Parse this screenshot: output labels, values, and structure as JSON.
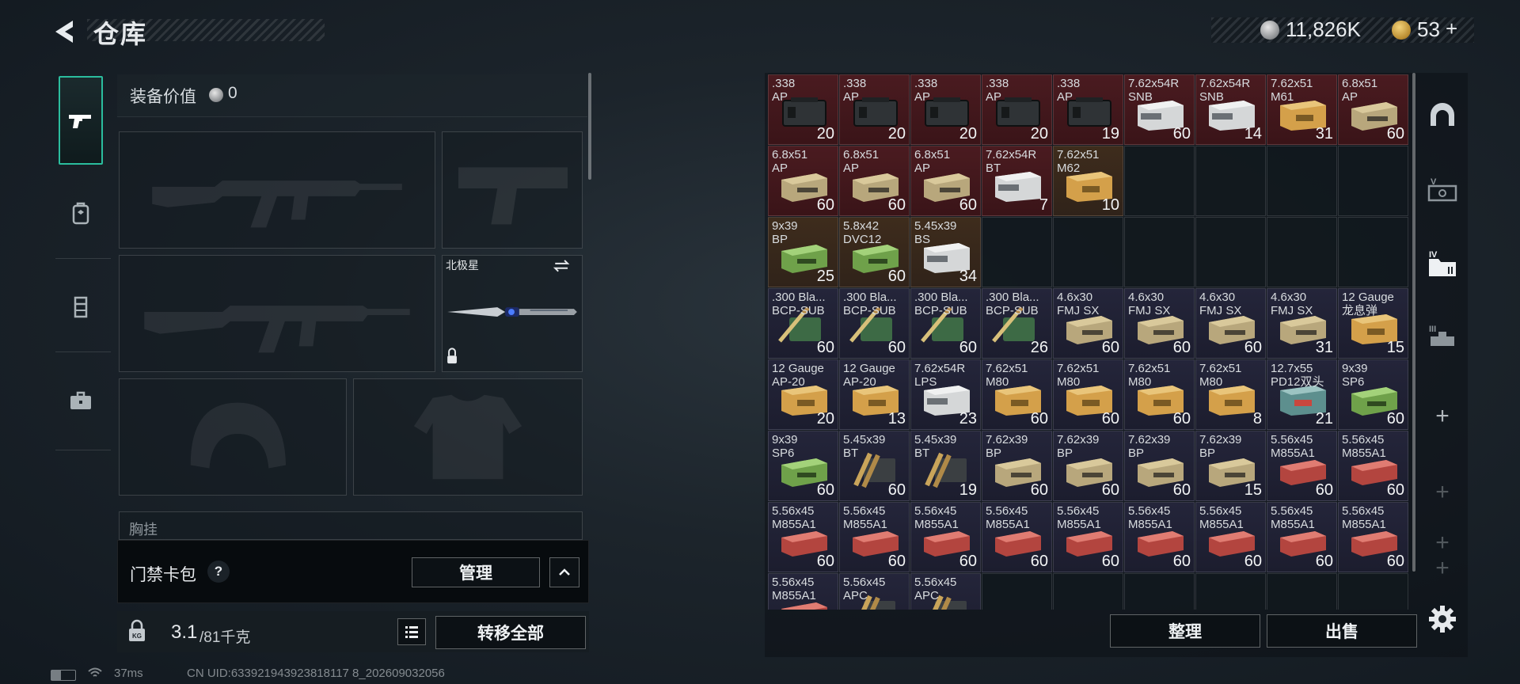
{
  "header": {
    "title": "仓库",
    "currency": [
      {
        "icon": "silver-coin-icon",
        "value": "11,826K"
      },
      {
        "icon": "gold-coin-icon",
        "value": "53"
      }
    ]
  },
  "side_nav": [
    {
      "icon": "pistol-icon",
      "active": true
    },
    {
      "icon": "backpack-plate-icon",
      "active": false
    },
    {
      "icon": "vest-icon",
      "active": false
    },
    {
      "icon": "briefcase-icon",
      "active": false
    }
  ],
  "loadout": {
    "value_label": "装备价值",
    "value_amount": "0",
    "melee_name": "北极星",
    "chest_label": "胸挂"
  },
  "keycard": {
    "label": "门禁卡包",
    "help": "?",
    "manage": "管理"
  },
  "weight": {
    "current": "3.1",
    "max": "/81千克",
    "transfer_all": "转移全部"
  },
  "status": {
    "ping": "37ms",
    "uid": "CN UID:633921943923818117 8_202609032056"
  },
  "stash": {
    "sort_label": "整理",
    "sell_label": "出售",
    "rows": [
      [
        {
          "name": ".338\nAP",
          "count": "20",
          "tone": "red",
          "box": "dark"
        },
        {
          "name": ".338\nAP",
          "count": "20",
          "tone": "red",
          "box": "dark"
        },
        {
          "name": ".338\nAP",
          "count": "20",
          "tone": "red",
          "box": "dark"
        },
        {
          "name": ".338\nAP",
          "count": "20",
          "tone": "red",
          "box": "dark"
        },
        {
          "name": ".338\nAP",
          "count": "19",
          "tone": "red",
          "box": "dark"
        },
        {
          "name": "7.62x54R\nSNB",
          "count": "60",
          "tone": "red",
          "box": "white"
        },
        {
          "name": "7.62x54R\nSNB",
          "count": "14",
          "tone": "red",
          "box": "white"
        },
        {
          "name": "7.62x51\nM61",
          "count": "31",
          "tone": "red",
          "box": "yellow"
        },
        {
          "name": "6.8x51\nAP",
          "count": "60",
          "tone": "red",
          "box": "tan"
        }
      ],
      [
        {
          "name": "6.8x51\nAP",
          "count": "60",
          "tone": "red",
          "box": "tan"
        },
        {
          "name": "6.8x51\nAP",
          "count": "60",
          "tone": "red",
          "box": "tan"
        },
        {
          "name": "6.8x51\nAP",
          "count": "60",
          "tone": "red",
          "box": "tan"
        },
        {
          "name": "7.62x54R\nBT",
          "count": "7",
          "tone": "red",
          "box": "white"
        },
        {
          "name": "7.62x51\nM62",
          "count": "10",
          "tone": "brown",
          "box": "yellow"
        },
        null,
        null,
        null,
        null
      ],
      [
        {
          "name": "9x39\nBP",
          "count": "25",
          "tone": "brown",
          "box": "green"
        },
        {
          "name": "5.8x42\nDVC12",
          "count": "60",
          "tone": "brown",
          "box": "green"
        },
        {
          "name": "5.45x39\nBS",
          "count": "34",
          "tone": "brown",
          "box": "white"
        },
        null,
        null,
        null,
        null,
        null,
        null
      ],
      [
        {
          "name": ".300 Bla...\nBCP-SUB",
          "count": "60",
          "tone": "purple",
          "box": "greenround"
        },
        {
          "name": ".300 Bla...\nBCP-SUB",
          "count": "60",
          "tone": "purple",
          "box": "greenround"
        },
        {
          "name": ".300 Bla...\nBCP-SUB",
          "count": "60",
          "tone": "purple",
          "box": "greenround"
        },
        {
          "name": ".300 Bla...\nBCP-SUB",
          "count": "26",
          "tone": "purple",
          "box": "greenround"
        },
        {
          "name": "4.6x30\nFMJ SX",
          "count": "60",
          "tone": "purple",
          "box": "tan"
        },
        {
          "name": "4.6x30\nFMJ SX",
          "count": "60",
          "tone": "purple",
          "box": "tan"
        },
        {
          "name": "4.6x30\nFMJ SX",
          "count": "60",
          "tone": "purple",
          "box": "tan"
        },
        {
          "name": "4.6x30\nFMJ SX",
          "count": "31",
          "tone": "purple",
          "box": "tan"
        },
        {
          "name": "12 Gauge\n龙息弹",
          "count": "15",
          "tone": "purple",
          "box": "yellow"
        }
      ],
      [
        {
          "name": "12 Gauge\nAP-20",
          "count": "20",
          "tone": "purple",
          "box": "yellow"
        },
        {
          "name": "12 Gauge\nAP-20",
          "count": "13",
          "tone": "purple",
          "box": "yellow"
        },
        {
          "name": "7.62x54R\nLPS",
          "count": "23",
          "tone": "purple",
          "box": "white"
        },
        {
          "name": "7.62x51\nM80",
          "count": "60",
          "tone": "purple",
          "box": "yellow"
        },
        {
          "name": "7.62x51\nM80",
          "count": "60",
          "tone": "purple",
          "box": "yellow"
        },
        {
          "name": "7.62x51\nM80",
          "count": "60",
          "tone": "purple",
          "box": "yellow"
        },
        {
          "name": "7.62x51\nM80",
          "count": "8",
          "tone": "purple",
          "box": "yellow"
        },
        {
          "name": "12.7x55\nPD12双头",
          "count": "21",
          "tone": "purple",
          "box": "teal"
        },
        {
          "name": "9x39\nSP6",
          "count": "60",
          "tone": "purple",
          "box": "green"
        }
      ],
      [
        {
          "name": "9x39\nSP6",
          "count": "60",
          "tone": "purple",
          "box": "green"
        },
        {
          "name": "5.45x39\nBT",
          "count": "60",
          "tone": "purple",
          "box": "bullets"
        },
        {
          "name": "5.45x39\nBT",
          "count": "19",
          "tone": "purple",
          "box": "bullets"
        },
        {
          "name": "7.62x39\nBP",
          "count": "60",
          "tone": "purple",
          "box": "tan"
        },
        {
          "name": "7.62x39\nBP",
          "count": "60",
          "tone": "purple",
          "box": "tan"
        },
        {
          "name": "7.62x39\nBP",
          "count": "60",
          "tone": "purple",
          "box": "tan"
        },
        {
          "name": "7.62x39\nBP",
          "count": "15",
          "tone": "purple",
          "box": "tan"
        },
        {
          "name": "5.56x45\nM855A1",
          "count": "60",
          "tone": "purple",
          "box": "red"
        },
        {
          "name": "5.56x45\nM855A1",
          "count": "60",
          "tone": "purple",
          "box": "red"
        }
      ],
      [
        {
          "name": "5.56x45\nM855A1",
          "count": "60",
          "tone": "purple",
          "box": "red"
        },
        {
          "name": "5.56x45\nM855A1",
          "count": "60",
          "tone": "purple",
          "box": "red"
        },
        {
          "name": "5.56x45\nM855A1",
          "count": "60",
          "tone": "purple",
          "box": "red"
        },
        {
          "name": "5.56x45\nM855A1",
          "count": "60",
          "tone": "purple",
          "box": "red"
        },
        {
          "name": "5.56x45\nM855A1",
          "count": "60",
          "tone": "purple",
          "box": "red"
        },
        {
          "name": "5.56x45\nM855A1",
          "count": "60",
          "tone": "purple",
          "box": "red"
        },
        {
          "name": "5.56x45\nM855A1",
          "count": "60",
          "tone": "purple",
          "box": "red"
        },
        {
          "name": "5.56x45\nM855A1",
          "count": "60",
          "tone": "purple",
          "box": "red"
        },
        {
          "name": "5.56x45\nM855A1",
          "count": "60",
          "tone": "purple",
          "box": "red"
        }
      ],
      [
        {
          "name": "5.56x45\nM855A1",
          "count": "",
          "tone": "purple",
          "box": "red"
        },
        {
          "name": "5.56x45\nAPC",
          "count": "",
          "tone": "purple",
          "box": "bullets"
        },
        {
          "name": "5.56x45\nAPC",
          "count": "",
          "tone": "purple",
          "box": "bullets"
        },
        null,
        null,
        null,
        null,
        null,
        null
      ]
    ]
  },
  "right_nav": [
    {
      "icon": "helmet-arch-icon"
    },
    {
      "icon": "case-v-icon"
    },
    {
      "icon": "folder-iv-icon"
    },
    {
      "icon": "truck-iii-icon"
    }
  ],
  "colors": {
    "accent": "#2bbd9e",
    "red_cell": "#4a1b20",
    "purple_cell": "#24253a",
    "brown_cell": "#3e2c1c"
  }
}
